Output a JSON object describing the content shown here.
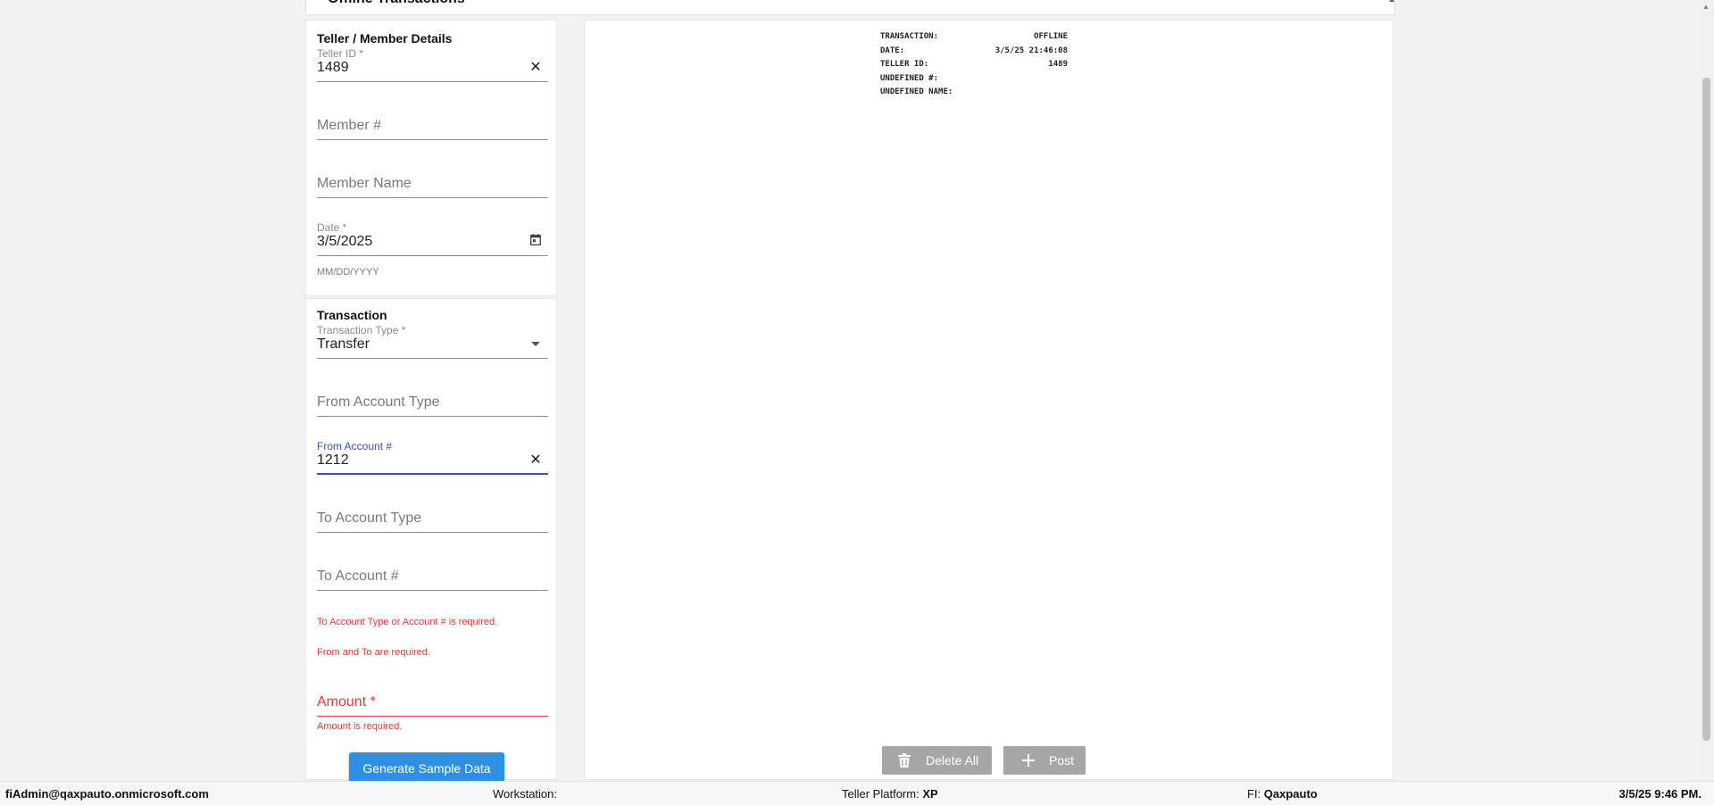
{
  "page": {
    "title": "Offline Transactions"
  },
  "details": {
    "title": "Teller / Member Details",
    "teller_id": {
      "label": "Teller ID *",
      "value": "1489",
      "clear_icon": "close-icon"
    },
    "member_number": {
      "placeholder": "Member #"
    },
    "member_name": {
      "placeholder": "Member Name"
    },
    "date": {
      "label": "Date *",
      "value": "3/5/2025",
      "helper": "MM/DD/YYYY",
      "icon": "calendar-icon"
    }
  },
  "transaction": {
    "title": "Transaction",
    "type": {
      "label": "Transaction Type *",
      "value": "Transfer",
      "icon": "dropdown-arrow-icon"
    },
    "from_account_type": {
      "placeholder": "From Account Type"
    },
    "from_account_number": {
      "label": "From Account #",
      "value": "1212",
      "clear_icon": "close-icon"
    },
    "to_account_type": {
      "placeholder": "To Account Type"
    },
    "to_account_number": {
      "placeholder": "To Account #"
    },
    "errors": {
      "to_required": "To Account Type or Account # is required.",
      "from_to_required": "From and To are required."
    },
    "amount": {
      "placeholder": "Amount *",
      "error": "Amount is required."
    },
    "generate_label": "Generate Sample Data"
  },
  "receipt": {
    "rows": [
      {
        "label": "TRANSACTION:",
        "value": "OFFLINE"
      },
      {
        "label": "DATE:",
        "value": "3/5/25 21:46:08"
      },
      {
        "label": "TELLER ID:",
        "value": "1489"
      },
      {
        "label": "UNDEFINED #:",
        "value": ""
      },
      {
        "label": "UNDEFINED NAME:",
        "value": ""
      }
    ],
    "delete_all_label": "Delete All",
    "post_label": "Post"
  },
  "footer": {
    "user": "fiAdmin@qaxpauto.onmicrosoft.com",
    "workstation_label": "Workstation:",
    "workstation_value": "",
    "platform_label": "Teller Platform:",
    "platform_value": "XP",
    "fi_label": "FI:",
    "fi_value": "Qaxpauto",
    "datetime": "3/5/25 9:46 PM."
  },
  "colors": {
    "accent_blue": "#2f8fe0",
    "focus_indigo": "#3f51b5",
    "error_red": "#e53935",
    "disabled_gray": "#a6a6a6"
  }
}
